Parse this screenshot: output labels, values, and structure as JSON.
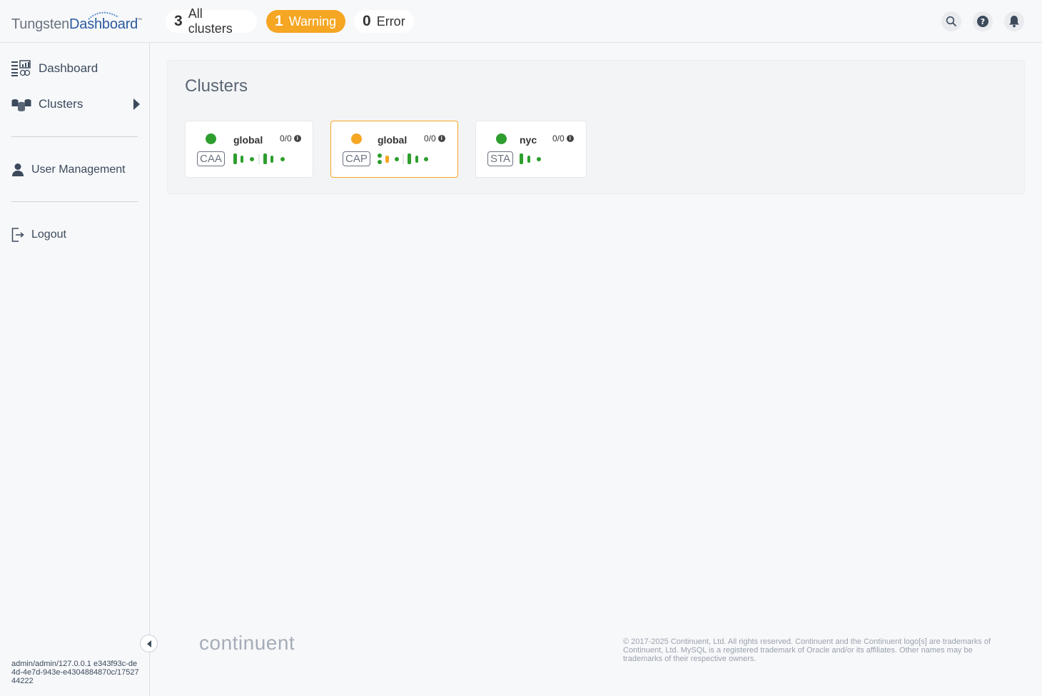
{
  "app": {
    "logo_part1": "Tungsten",
    "logo_part2": "Dashboard",
    "logo_tm": "™"
  },
  "summary": {
    "all": {
      "count": "3",
      "label": "All clusters"
    },
    "warning": {
      "count": "1",
      "label": "Warning"
    },
    "error": {
      "count": "0",
      "label": "Error"
    }
  },
  "header_icons": [
    "search-icon",
    "help-icon",
    "bell-icon"
  ],
  "sidebar": {
    "items": [
      {
        "label": "Dashboard",
        "icon": "dashboard-icon"
      },
      {
        "label": "Clusters",
        "icon": "clusters-icon"
      },
      {
        "label": "User Management",
        "icon": "user-icon"
      },
      {
        "label": "Logout",
        "icon": "logout-icon"
      }
    ],
    "session": "admin/admin/127.0.0.1 e343f93c-de4d-4e7d-943e-e4304884870c/1752744222"
  },
  "main": {
    "title": "Clusters",
    "clusters": [
      {
        "name": "global",
        "type": "CAA",
        "count": "0/0",
        "status": "ok",
        "status_color": "#2e9e2e"
      },
      {
        "name": "global",
        "type": "CAP",
        "count": "0/0",
        "status": "warning",
        "status_color": "#f5a623"
      },
      {
        "name": "nyc",
        "type": "STA",
        "count": "0/0",
        "status": "ok",
        "status_color": "#2e9e2e"
      }
    ]
  },
  "footer": {
    "brand": "continuent",
    "copyright": "© 2017-2025 Continuent, Ltd. All rights reserved. Continuent and the Continuent logo[s] are trademarks of Continuent, Ltd. MySQL is a registered trademark of Oracle and/or its affiliates. Other names may be trademarks of their respective owners."
  },
  "colors": {
    "brand_blue": "#2c5aa0",
    "warning": "#f5a623",
    "ok": "#2e9e2e"
  }
}
